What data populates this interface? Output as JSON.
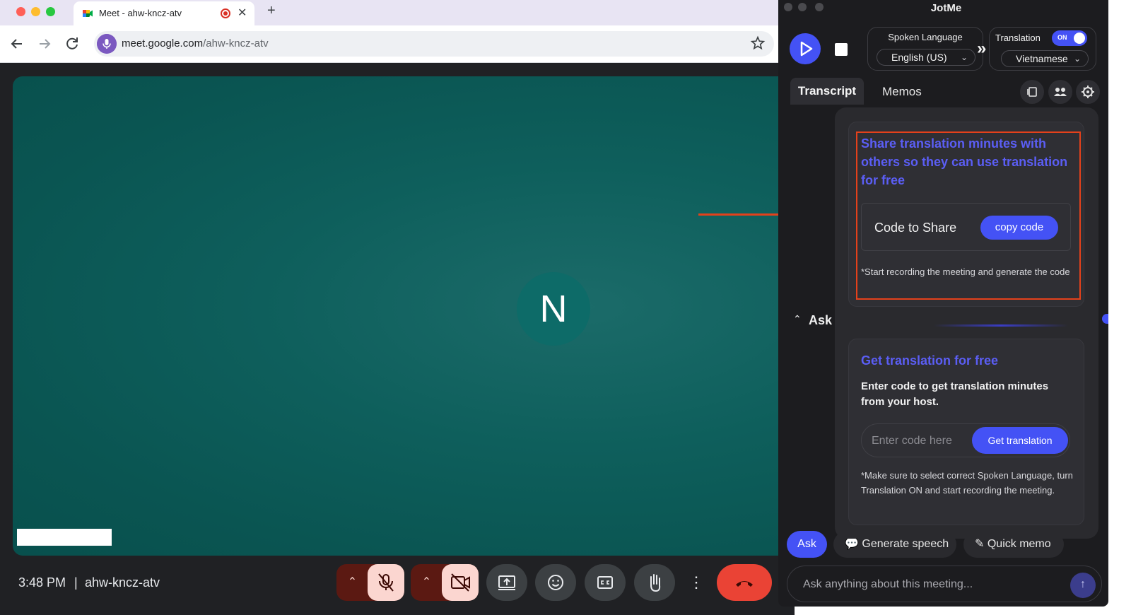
{
  "browser": {
    "tab_title": "Meet - ahw-kncz-atv",
    "new_tab_label": "+",
    "tab_close": "✕",
    "url_domain": "meet.google.com",
    "url_path": "/ahw-kncz-atv"
  },
  "meet": {
    "avatar_initial": "N",
    "time": "3:48 PM",
    "separator": "|",
    "meeting_code": "ahw-kncz-atv",
    "more_icon": "⋮",
    "colors": {
      "end_call": "#ea4335",
      "stage": "#0e5f5c"
    }
  },
  "jotme": {
    "title": "JotMe",
    "spoken_language_label": "Spoken Language",
    "spoken_language_value": "English (US)",
    "translation_label": "Translation",
    "translation_toggle": "ON",
    "translation_value": "Vietnamese",
    "tabs": {
      "transcript": "Transcript",
      "memos": "Memos"
    },
    "ask_section": "Ask",
    "popup": {
      "share_title": "Share translation minutes with others so they can use translation for free",
      "code_label": "Code to Share",
      "copy_button": "copy code",
      "share_note": "*Start recording the meeting and generate the code",
      "free_title": "Get translation for free",
      "free_desc": "Enter code to get translation minutes from your host.",
      "code_placeholder": "Enter code here",
      "get_button": "Get translation",
      "free_note": "*Make sure to select correct Spoken Language, turn Translation ON and start recording the meeting."
    },
    "ask_button": "Ask",
    "generate_speech": "Generate speech",
    "quick_memo": "Quick memo",
    "ask_placeholder": "Ask anything about this meeting...",
    "colors": {
      "accent": "#4452f5",
      "highlight_box": "#e4411b"
    }
  }
}
